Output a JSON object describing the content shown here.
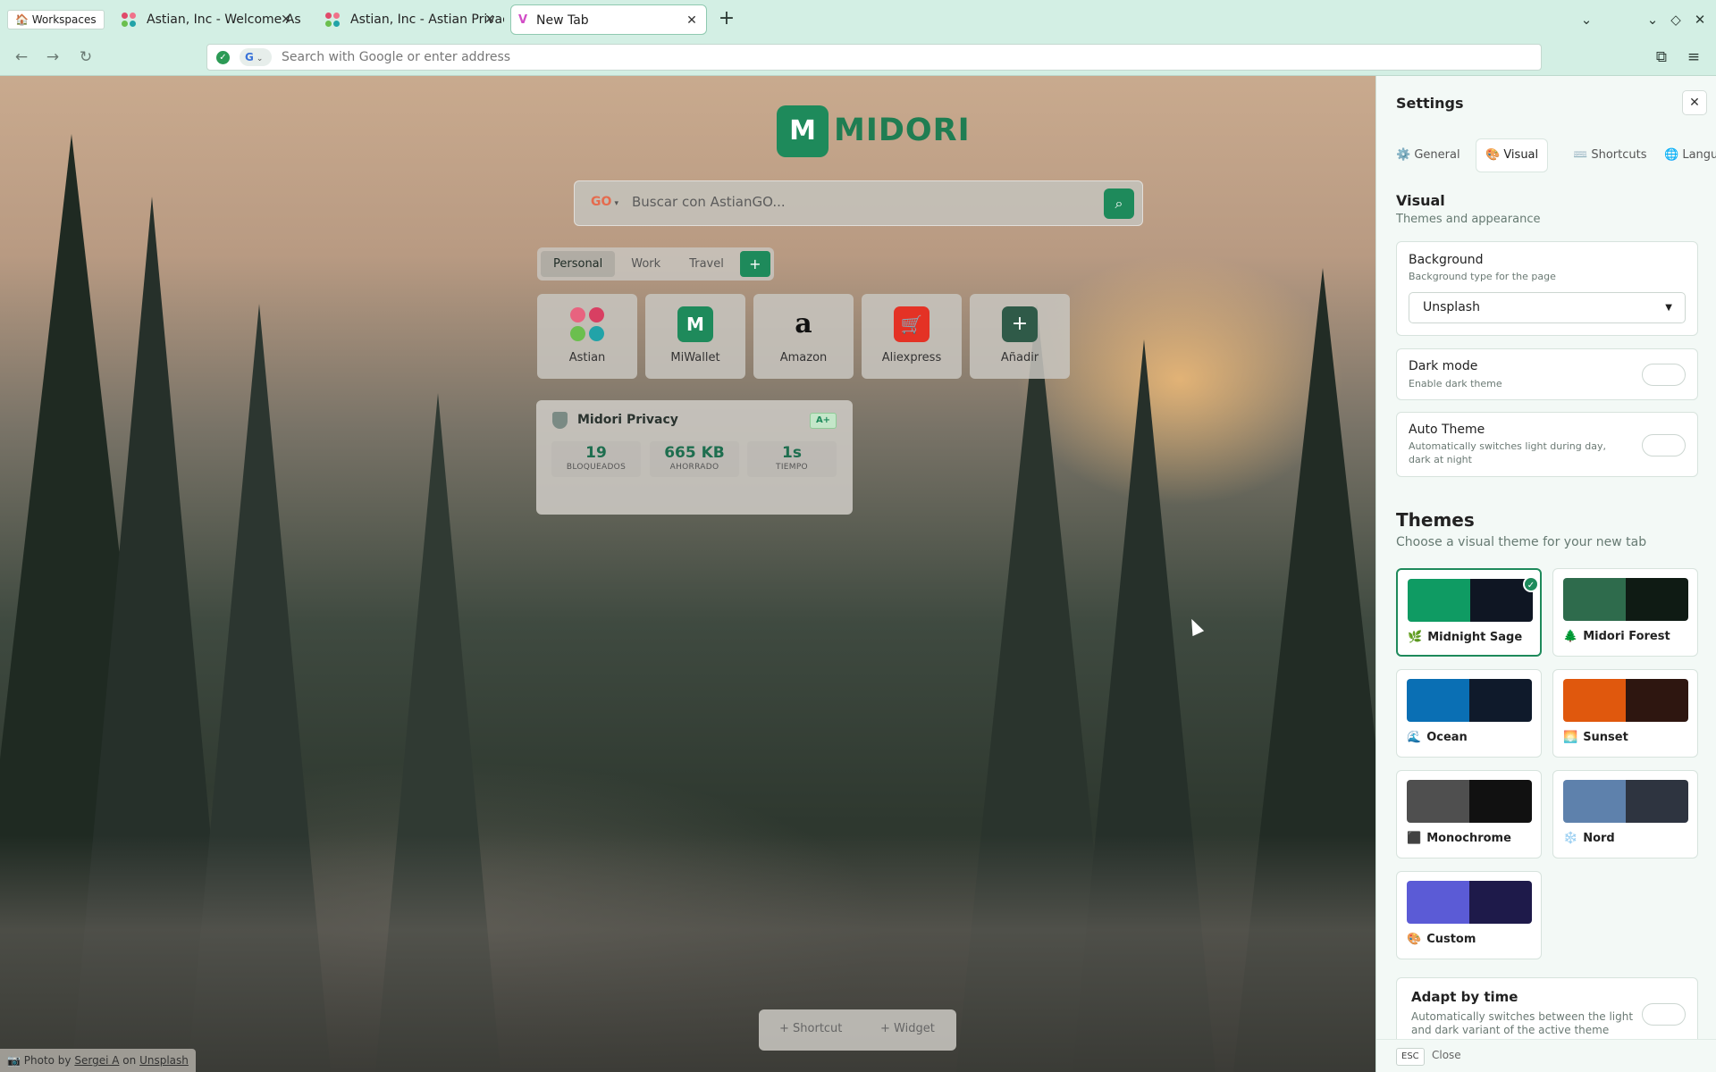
{
  "browser": {
    "workspaces_label": "🏠 Workspaces",
    "tabs": [
      {
        "title": "Astian, Inc - Welcome Astian"
      },
      {
        "title": "Astian, Inc - Astian Privacy"
      },
      {
        "title": "New Tab"
      }
    ],
    "address_placeholder": "Search with Google or enter address"
  },
  "newtab": {
    "logo_text": "MIDORI",
    "search_placeholder": "Buscar con AstianGO...",
    "workspace_tabs": [
      "Personal",
      "Work",
      "Travel"
    ],
    "add_symbol": "+",
    "shortcuts": [
      {
        "label": "Astian"
      },
      {
        "label": "MiWallet"
      },
      {
        "label": "Amazon"
      },
      {
        "label": "Aliexpress"
      },
      {
        "label": "Añadir"
      }
    ],
    "privacy": {
      "title": "Midori Privacy",
      "grade": "A+",
      "stats": [
        {
          "value": "19",
          "label": "BLOQUEADOS"
        },
        {
          "value": "665 KB",
          "label": "AHORRADO"
        },
        {
          "value": "1s",
          "label": "TIEMPO"
        }
      ]
    },
    "bottom_actions": {
      "shortcut": "+ Shortcut",
      "widget": "+ Widget"
    },
    "credit": {
      "prefix": "📷 Photo by",
      "author": "Sergei A",
      "on": "on",
      "source": "Unsplash"
    }
  },
  "settings": {
    "title": "Settings",
    "close_symbol": "✕",
    "tabs": [
      {
        "icon": "⚙️",
        "label": "General"
      },
      {
        "icon": "🎨",
        "label": "Visual"
      },
      {
        "icon": "⌨️",
        "label": "Shortcuts"
      },
      {
        "icon": "🌐",
        "label": "Langua"
      }
    ],
    "section_title": "Visual",
    "section_subtitle": "Themes and appearance",
    "background": {
      "title": "Background",
      "desc": "Background type for the page",
      "value": "Unsplash"
    },
    "dark_mode": {
      "title": "Dark mode",
      "desc": "Enable dark theme",
      "enabled": false
    },
    "auto_theme": {
      "title": "Auto Theme",
      "desc": "Automatically switches light during day, dark at night",
      "enabled": false
    },
    "themes_title": "Themes",
    "themes_subtitle": "Choose a visual theme for your new tab",
    "themes": [
      {
        "emoji": "🌿",
        "name": "Midnight Sage",
        "colors": [
          "#0f9b63",
          "#0f1623"
        ],
        "selected": true
      },
      {
        "emoji": "🌲",
        "name": "Midori Forest",
        "colors": [
          "#2e6b4c",
          "#0f1b14"
        ],
        "selected": false
      },
      {
        "emoji": "🌊",
        "name": "Ocean",
        "colors": [
          "#0a6fb4",
          "#0f1a2b"
        ],
        "selected": false
      },
      {
        "emoji": "🌅",
        "name": "Sunset",
        "colors": [
          "#e0580d",
          "#2e1610"
        ],
        "selected": false
      },
      {
        "emoji": "⬛",
        "name": "Monochrome",
        "colors": [
          "#4f4f4f",
          "#111111"
        ],
        "selected": false
      },
      {
        "emoji": "❄️",
        "name": "Nord",
        "colors": [
          "#5e81ac",
          "#2e3440"
        ],
        "selected": false
      },
      {
        "emoji": "🎨",
        "name": "Custom",
        "colors": [
          "#5b5bd6",
          "#1e1a4a"
        ],
        "selected": false
      }
    ],
    "adapt": {
      "title": "Adapt by time",
      "desc": "Automatically switches between the light and dark variant of the active theme"
    },
    "footer": {
      "key": "ESC",
      "label": "Close"
    }
  }
}
